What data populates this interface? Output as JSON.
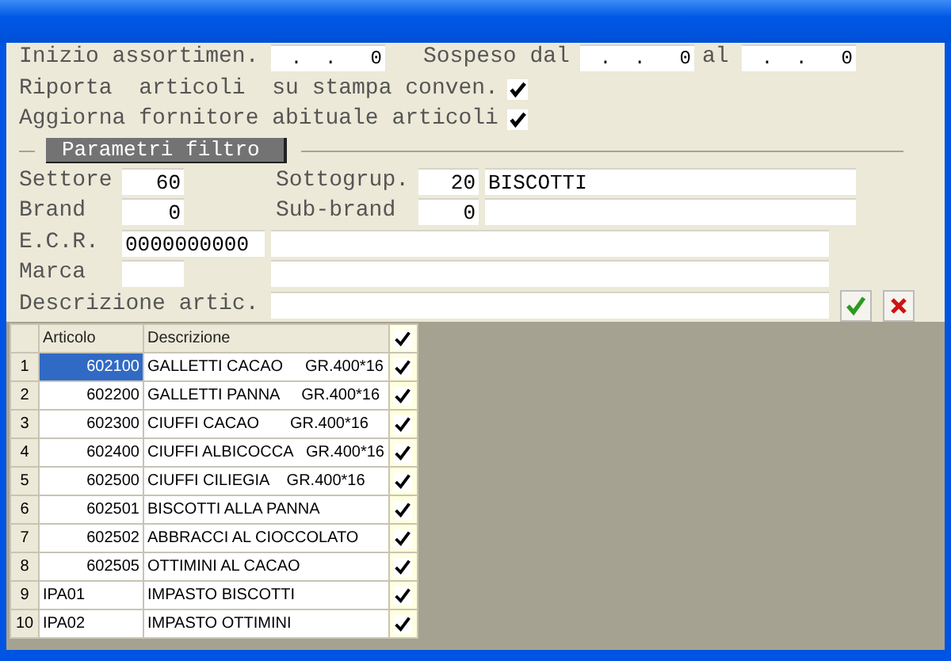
{
  "form": {
    "inizio": {
      "label": "Inizio assortimen.",
      "value": " .  .   0"
    },
    "sospeso_dal": {
      "label": "Sospeso dal",
      "value": " .  .   0"
    },
    "al": {
      "label": "al",
      "value": " .  .   0"
    },
    "riporta": {
      "label": "Riporta  articoli  su stampa conven.",
      "checked": true
    },
    "aggiorna": {
      "label": "Aggiorna fornitore abituale articoli",
      "checked": true
    }
  },
  "filter": {
    "title": "Parametri filtro",
    "settore": {
      "label": "Settore",
      "value": "60"
    },
    "sottogruppo": {
      "label": "Sottogrup.",
      "code": "20",
      "name": "BISCOTTI"
    },
    "brand": {
      "label": "Brand",
      "value": "0"
    },
    "sub_brand": {
      "label": "Sub-brand",
      "code": "0"
    },
    "ecr": {
      "label": "E.C.R.",
      "code": "0000000000"
    },
    "marca": {
      "label": "Marca"
    },
    "descrizione": {
      "label": "Descrizione artic."
    }
  },
  "grid": {
    "columns": [
      "Articolo",
      "Descrizione"
    ],
    "header_checked": true,
    "rows": [
      {
        "number": "1",
        "articolo": "602100",
        "kind": "numeric",
        "descrizione": "GALLETTI CACAO     GR.400*16",
        "checked": true,
        "selected": true
      },
      {
        "number": "2",
        "articolo": "602200",
        "kind": "numeric",
        "descrizione": "GALLETTI PANNA     GR.400*16",
        "checked": true,
        "selected": false
      },
      {
        "number": "3",
        "articolo": "602300",
        "kind": "numeric",
        "descrizione": "CIUFFI CACAO       GR.400*16",
        "checked": true,
        "selected": false
      },
      {
        "number": "4",
        "articolo": "602400",
        "kind": "numeric",
        "descrizione": "CIUFFI ALBICOCCA   GR.400*16",
        "checked": true,
        "selected": false
      },
      {
        "number": "5",
        "articolo": "602500",
        "kind": "numeric",
        "descrizione": "CIUFFI CILIEGIA    GR.400*16",
        "checked": true,
        "selected": false
      },
      {
        "number": "6",
        "articolo": "602501",
        "kind": "numeric",
        "descrizione": "BISCOTTI ALLA PANNA",
        "checked": true,
        "selected": false
      },
      {
        "number": "7",
        "articolo": "602502",
        "kind": "numeric",
        "descrizione": "ABBRACCI AL CIOCCOLATO",
        "checked": true,
        "selected": false
      },
      {
        "number": "8",
        "articolo": "602505",
        "kind": "numeric",
        "descrizione": "OTTIMINI AL CACAO",
        "checked": true,
        "selected": false
      },
      {
        "number": "9",
        "articolo": "IPA01",
        "kind": "text",
        "descrizione": "IMPASTO BISCOTTI",
        "checked": true,
        "selected": false
      },
      {
        "number": "10",
        "articolo": "IPA02",
        "kind": "text",
        "descrizione": "IMPASTO OTTIMINI",
        "checked": true,
        "selected": false
      }
    ]
  }
}
